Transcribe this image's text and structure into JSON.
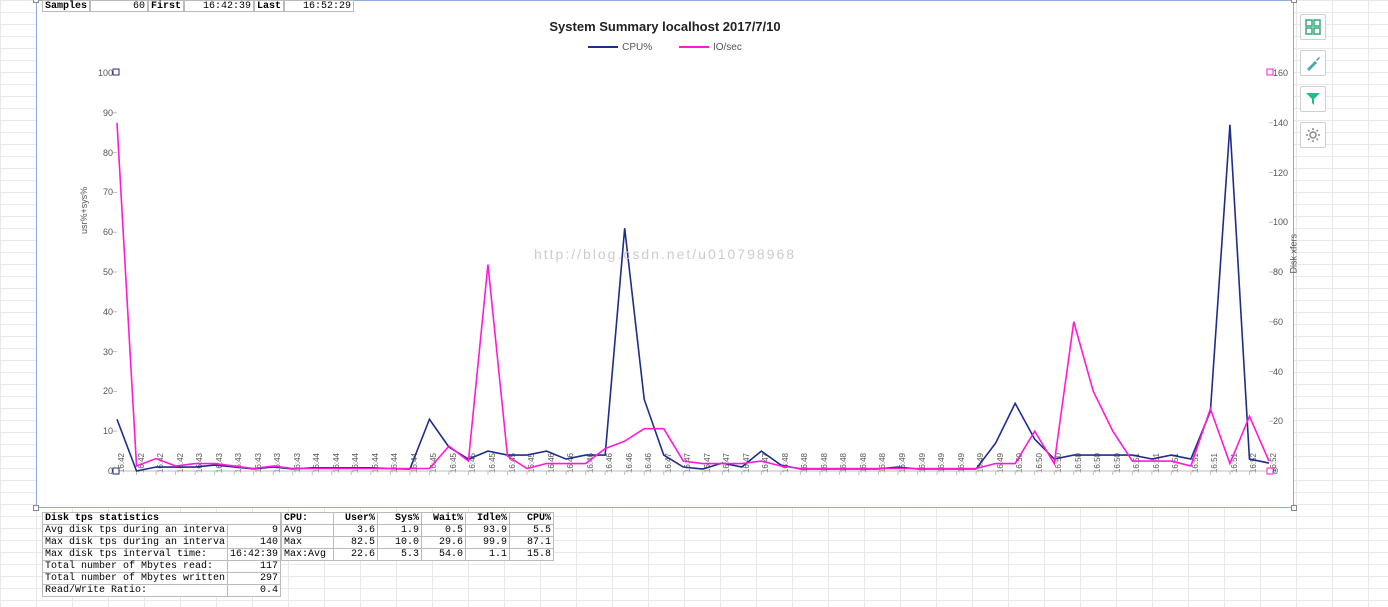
{
  "top": {
    "samples_label": "Samples",
    "samples_value": "60",
    "first_label": "First",
    "first_value": "16:42:39",
    "last_label": "Last",
    "last_value": "16:52:29"
  },
  "watermark": "http://blog.csdn.net/u010798968",
  "chart_data": {
    "type": "line",
    "title": "System Summary localhost  2017/7/10",
    "ylabel_left": "usr%+sys%",
    "ylabel_right": "Disk xfers",
    "ylim_left": [
      0,
      100
    ],
    "ylim_right": [
      0,
      160
    ],
    "yticks_left": [
      0,
      10,
      20,
      30,
      40,
      50,
      60,
      70,
      80,
      90,
      100
    ],
    "yticks_right": [
      0,
      20,
      40,
      60,
      80,
      100,
      120,
      140,
      160
    ],
    "categories": [
      "16:42",
      "16:42",
      "16:42",
      "16:42",
      "16:43",
      "16:43",
      "16:43",
      "16:43",
      "16:43",
      "16:43",
      "16:44",
      "16:44",
      "16:44",
      "16:44",
      "16:44",
      "16:44",
      "16:45",
      "16:45",
      "16:45",
      "16:45",
      "16:45",
      "16:45",
      "16:46",
      "16:46",
      "16:46",
      "16:46",
      "16:46",
      "16:46",
      "16:47",
      "16:47",
      "16:47",
      "16:47",
      "16:47",
      "16:47",
      "16:48",
      "16:48",
      "16:48",
      "16:48",
      "16:48",
      "16:48",
      "16:49",
      "16:49",
      "16:49",
      "16:49",
      "16:49",
      "16:49",
      "16:50",
      "16:50",
      "16:50",
      "16:50",
      "16:50",
      "16:50",
      "16:51",
      "16:51",
      "16:51",
      "16:51",
      "16:51",
      "16:51",
      "16:52",
      "16:52"
    ],
    "series": [
      {
        "name": "CPU%",
        "color": "#1f2d8a",
        "axis": "left",
        "values": [
          13,
          0,
          1,
          1,
          1,
          1.5,
          1,
          0.5,
          1,
          0.5,
          0.8,
          0.8,
          0.8,
          0.8,
          0.6,
          0.5,
          13,
          6,
          3,
          5,
          4,
          4,
          5,
          3,
          4,
          4,
          61,
          18,
          4,
          1,
          0.5,
          2,
          1,
          5,
          1.5,
          0.5,
          0.5,
          0.5,
          0.5,
          0.5,
          1,
          0.5,
          0.5,
          0.5,
          0.5,
          7,
          17,
          8,
          3,
          4,
          4,
          4,
          4,
          3,
          4,
          3,
          15,
          87,
          3,
          2
        ]
      },
      {
        "name": "IO/sec",
        "color": "#ff1ad9",
        "axis": "right",
        "values": [
          140,
          2,
          5,
          2,
          3,
          3,
          2,
          1,
          2,
          1,
          1,
          1,
          1,
          1,
          1,
          1,
          1,
          10,
          4,
          83,
          6,
          1,
          3,
          3,
          3,
          9,
          12,
          17,
          17,
          4,
          3,
          3,
          3,
          4,
          2,
          1,
          1,
          1,
          1,
          1,
          1,
          1,
          1,
          1,
          1,
          3,
          3,
          16,
          3,
          60,
          32,
          16,
          4,
          4,
          4,
          2,
          25,
          3,
          22,
          4
        ]
      }
    ],
    "legend": [
      "CPU%",
      "IO/sec"
    ]
  },
  "disk_stats": {
    "header": "Disk tps statistics",
    "rows": [
      {
        "label": "Avg disk tps during an interva",
        "value": "9"
      },
      {
        "label": "Max disk tps during an interva",
        "value": "140"
      },
      {
        "label": "Max disk tps interval time:",
        "value": "16:42:39"
      },
      {
        "label": "Total number of Mbytes read:",
        "value": "117"
      },
      {
        "label": "Total number of Mbytes written",
        "value": "297"
      },
      {
        "label": "Read/Write Ratio:",
        "value": "0.4"
      }
    ]
  },
  "cpu_stats": {
    "cpu_header": "CPU:",
    "columns": [
      "User%",
      "Sys%",
      "Wait%",
      "Idle%",
      "CPU%"
    ],
    "rows": [
      {
        "label": "Avg",
        "cells": [
          "3.6",
          "1.9",
          "0.5",
          "93.9",
          "5.5"
        ]
      },
      {
        "label": "Max",
        "cells": [
          "82.5",
          "10.0",
          "29.6",
          "99.9",
          "87.1"
        ]
      },
      {
        "label": "Max:Avg",
        "cells": [
          "22.6",
          "5.3",
          "54.0",
          "1.1",
          "15.8"
        ]
      }
    ]
  },
  "tools": {
    "chart_elements": "chart-elements",
    "chart_styles": "chart-styles",
    "chart_filters": "chart-filters",
    "chart_settings": "chart-settings"
  }
}
